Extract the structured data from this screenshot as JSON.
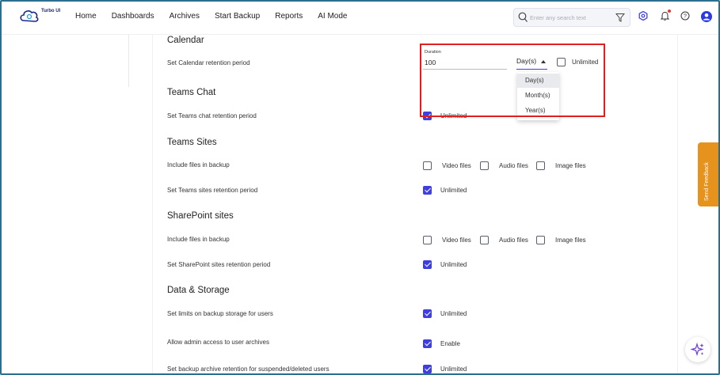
{
  "app": {
    "logo_text": "Turbo UI"
  },
  "nav": [
    "Home",
    "Dashboards",
    "Archives",
    "Start Backup",
    "Reports",
    "AI Mode"
  ],
  "search": {
    "placeholder": "Enter any search text"
  },
  "sections": {
    "calendar": {
      "title": "Calendar",
      "retention_label": "Set Calendar retention period",
      "duration_label": "Duration",
      "duration_value": "100",
      "unit_selected": "Day(s)",
      "unit_options": [
        "Day(s)",
        "Month(s)",
        "Year(s)"
      ],
      "unlimited": "Unlimited"
    },
    "teams_chat": {
      "title": "Teams Chat",
      "retention_label": "Set Teams chat retention period",
      "unlimited": "Unlimited"
    },
    "teams_sites": {
      "title": "Teams Sites",
      "include_label": "Include files in backup",
      "video": "Video files",
      "audio": "Audio files",
      "image": "Image files",
      "retention_label": "Set Teams sites retention period",
      "unlimited": "Unlimited"
    },
    "sharepoint": {
      "title": "SharePoint sites",
      "include_label": "Include files in backup",
      "video": "Video files",
      "audio": "Audio files",
      "image": "Image files",
      "retention_label": "Set SharePoint sites retention period",
      "unlimited": "Unlimited"
    },
    "data_storage": {
      "title": "Data & Storage",
      "limits_label": "Set limits on backup storage for users",
      "limits_value": "Unlimited",
      "admin_label": "Allow admin access to user archives",
      "admin_value": "Enable",
      "retention_label": "Set backup archive retention for suspended/deleted users",
      "retention_value": "Unlimited"
    }
  },
  "feedback": {
    "label": "Send Feedback"
  },
  "colors": {
    "accent": "#3f3fe0",
    "highlight": "#e02020",
    "feedback": "#e5931c"
  },
  "icons": [
    "search-icon",
    "filter-icon",
    "settings-icon",
    "bell-icon",
    "help-icon",
    "user-icon",
    "sparkle-icon"
  ]
}
